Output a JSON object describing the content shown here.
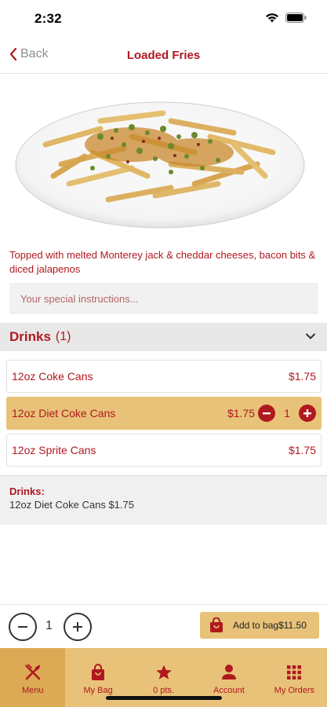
{
  "status": {
    "time": "2:32"
  },
  "nav": {
    "back_label": "Back",
    "title": "Loaded Fries"
  },
  "item": {
    "image_icon": "loaded-fries-photo",
    "description": "Topped with melted Monterey jack & cheddar cheeses, bacon bits & diced jalapenos",
    "instructions_placeholder": "Your special instructions..."
  },
  "drinks": {
    "title": "Drinks",
    "count": "(1)",
    "options": [
      {
        "name": "12oz Coke Cans",
        "price": "$1.75",
        "selected": false
      },
      {
        "name": "12oz Diet Coke Cans",
        "price": "$1.75",
        "selected": true,
        "qty": "1"
      },
      {
        "name": "12oz Sprite Cans",
        "price": "$1.75",
        "selected": false
      }
    ]
  },
  "summary": {
    "title": "Drinks:",
    "line": "12oz Diet Coke Cans $1.75"
  },
  "order": {
    "quantity": "1",
    "add_label": "Add to bag",
    "total": "$11.50"
  },
  "tabs": [
    {
      "label": "Menu",
      "icon": "fork-knife-icon",
      "active": true
    },
    {
      "label": "My Bag",
      "icon": "bag-icon",
      "active": false
    },
    {
      "label": "0 pts.",
      "icon": "star-icon",
      "active": false
    },
    {
      "label": "Account",
      "icon": "person-icon",
      "active": false
    },
    {
      "label": "My Orders",
      "icon": "grid-icon",
      "active": false
    }
  ],
  "colors": {
    "brand_red": "#b01820",
    "gold": "#e8c278",
    "gold_dark": "#dcaa55"
  }
}
